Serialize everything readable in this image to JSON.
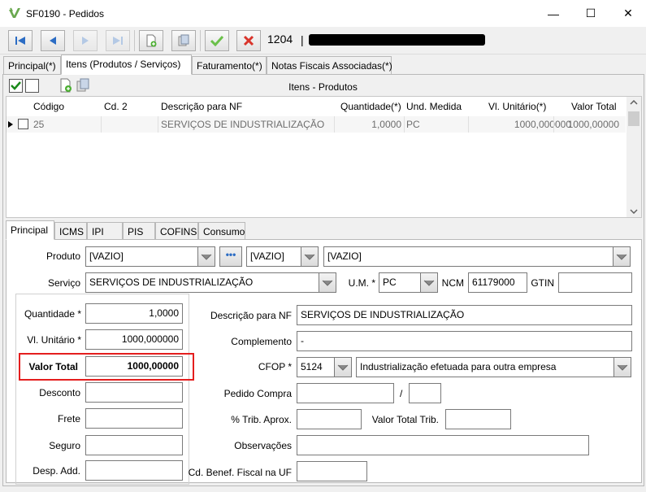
{
  "window": {
    "title": "SF0190 - Pedidos",
    "minimize_glyph": "—",
    "maximize_glyph": "☐",
    "close_glyph": "✕"
  },
  "toolbar": {
    "record_number": "1204",
    "record_separator": "|"
  },
  "main_tabs": [
    "Principal(*)",
    "Itens (Produtos / Serviços)",
    "Faturamento(*)",
    "Notas Fiscais Associadas(*)"
  ],
  "grid": {
    "title": "Itens - Produtos",
    "columns": [
      "Código",
      "Cd. 2",
      "Descrição para NF",
      "Quantidade(*)",
      "Und. Medida",
      "Vl. Unitário(*)",
      "Valor Total"
    ],
    "rows": [
      [
        "25",
        "",
        "SERVIÇOS DE INDUSTRIALIZAÇÃO",
        "1,0000",
        "PC",
        "1000,000000",
        "1000,00000"
      ]
    ]
  },
  "detail_tabs": [
    "Principal",
    "ICMS",
    "IPI",
    "PIS",
    "COFINS",
    "Consumo"
  ],
  "form": {
    "produto_label": "Produto",
    "produto_value": "[VAZIO]",
    "produto_ref_value": "[VAZIO]",
    "produto_desc_value": "[VAZIO]",
    "servico_label": "Serviço",
    "servico_value": "SERVIÇOS DE INDUSTRIALIZAÇÃO",
    "um_label": "U.M. *",
    "um_value": "PC",
    "ncm_label": "NCM",
    "ncm_value": "61179000",
    "gtin_label": "GTIN",
    "gtin_value": "",
    "quantidade_label": "Quantidade *",
    "quantidade_value": "1,0000",
    "vl_unitario_label": "Vl. Unitário *",
    "vl_unitario_value": "1000,000000",
    "valor_total_label": "Valor Total",
    "valor_total_value": "1000,00000",
    "desconto_label": "Desconto",
    "frete_label": "Frete",
    "seguro_label": "Seguro",
    "desp_add_label": "Desp. Add.",
    "descricao_nf_label": "Descrição para NF",
    "descricao_nf_value": "SERVIÇOS DE INDUSTRIALIZAÇÃO",
    "complemento_label": "Complemento",
    "complemento_value": "-",
    "cfop_label": "CFOP *",
    "cfop_value": "5124",
    "cfop_desc_value": "Industrialização efetuada para outra empresa",
    "pedido_compra_label": "Pedido Compra",
    "pedido_compra_sep": "/",
    "trib_aprox_label": "% Trib. Aprox.",
    "valor_total_trib_label": "Valor Total Trib.",
    "observacoes_label": "Observações",
    "cd_benef_label": "Cd. Benef. Fiscal na UF"
  },
  "colors": {
    "highlight_border": "#e41e1e",
    "nav_blue": "#2b6cc4",
    "check_green": "#4caf32",
    "cancel_red": "#d9342b"
  }
}
